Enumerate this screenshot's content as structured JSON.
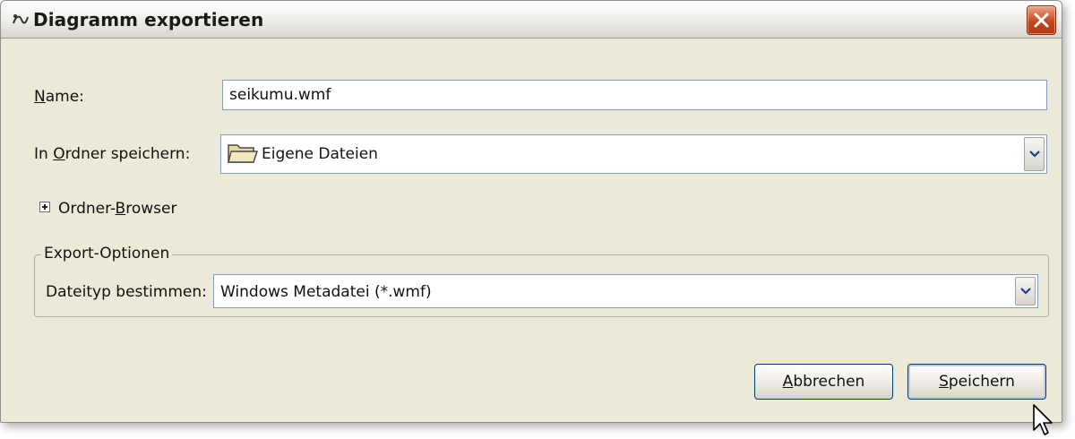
{
  "window": {
    "title": "Diagramm exportieren",
    "close_label": "Schließen"
  },
  "form": {
    "name": {
      "label_mnemonic": "N",
      "label_rest": "ame:",
      "value": "seikumu.wmf"
    },
    "folder": {
      "label_pre": "In ",
      "label_mnemonic": "O",
      "label_rest": "rdner speichern:",
      "value": "Eigene Dateien",
      "icon": "folder-icon"
    },
    "browser_toggle": {
      "label_pre": "Ordner-",
      "label_mnemonic": "B",
      "label_rest": "rowser",
      "state": "collapsed"
    }
  },
  "export_options": {
    "title": "Export-Optionen",
    "filetype_label": "Dateityp bestimmen:",
    "filetype_value": "Windows Metadatei (*.wmf)"
  },
  "buttons": {
    "cancel": {
      "mnemonic": "A",
      "rest": "bbrechen"
    },
    "save": {
      "mnemonic": "S",
      "rest": "peichern",
      "default": true
    }
  },
  "colors": {
    "dialog_bg": "#ece9d8",
    "field_border": "#7f9db9",
    "close_button": "#c2471f",
    "button_border": "#003c74"
  }
}
